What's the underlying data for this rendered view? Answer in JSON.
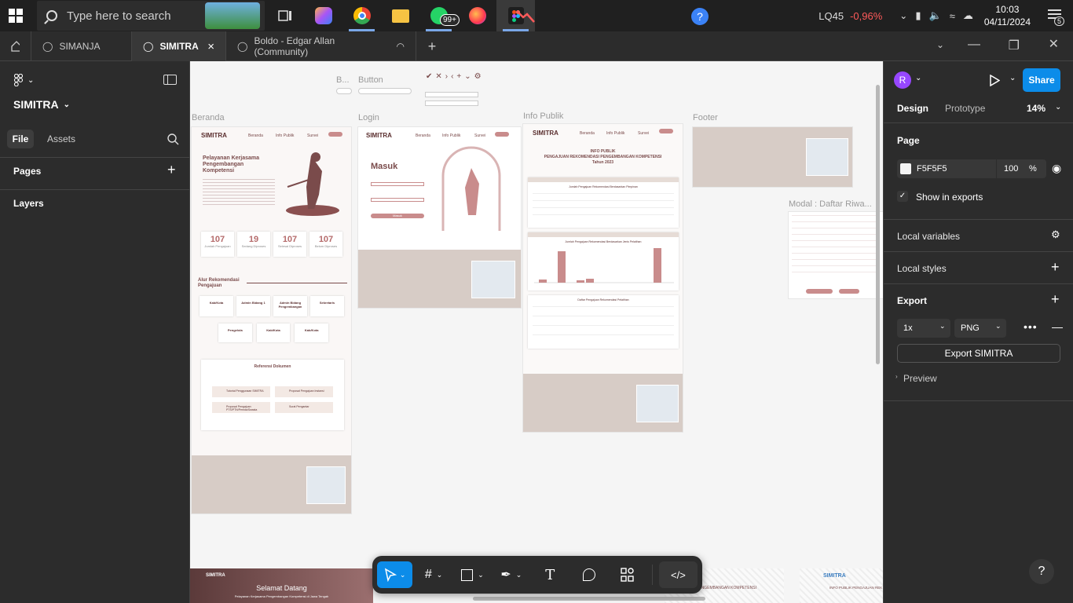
{
  "taskbar": {
    "search_placeholder": "Type here to search",
    "whatsapp_badge": "99+",
    "stock_name": "LQ45",
    "stock_change": "-0,96%",
    "time": "10:03",
    "date": "04/11/2024",
    "notification_count": "5"
  },
  "tabs": [
    {
      "label": "SIMANJA"
    },
    {
      "label": "SIMITRA"
    },
    {
      "label": "Boldo - Edgar Allan (Community)"
    }
  ],
  "left_panel": {
    "file_name": "SIMITRA",
    "tab_file": "File",
    "tab_assets": "Assets",
    "pages_label": "Pages",
    "layers_label": "Layers"
  },
  "canvas": {
    "labels": {
      "b": "B...",
      "button": "Button",
      "beranda": "Beranda",
      "login": "Login",
      "info_publik": "Info Publik",
      "footer": "Footer",
      "modal": "Modal : Daftar Riwa..."
    },
    "beranda": {
      "brand": "SIMITRA",
      "nav": [
        "Beranda",
        "Info Publik",
        "Survei"
      ],
      "hero_title": "Pelayanan Kerjasama Pengembangan Kompetensi",
      "stats": [
        {
          "value": "107",
          "label": "Jumlah Pengajuan"
        },
        {
          "value": "19",
          "label": "Sedang Diproses"
        },
        {
          "value": "107",
          "label": "Selesai Diproses"
        },
        {
          "value": "107",
          "label": "Belum Diproses"
        }
      ],
      "alur_title": "Alur Rekomendasi Pengajuan",
      "steps_row1": [
        "Kab/Kota",
        "Admin Bidang 1",
        "Admin Bidang Pengembangan",
        "Sekretaris"
      ],
      "steps_row2": [
        "Pengelola",
        "Kab/Kota",
        "Kab/Kota"
      ],
      "referensi_title": "Referensi Dokumen",
      "docs": [
        "Tutorial Penggunaan SIMITRA",
        "Proposal Pengajuan Instansi",
        "Proposal Pengajuan PTS/PTN/Pemda/Swasta",
        "Surat Pengantar"
      ]
    },
    "login": {
      "brand": "SIMITRA",
      "nav": [
        "Beranda",
        "Info Publik",
        "Survei"
      ],
      "title": "Masuk",
      "submit": "Masuk"
    },
    "info": {
      "brand": "SIMITRA",
      "nav": [
        "Beranda",
        "Info Publik",
        "Survei"
      ],
      "title1": "INFO PUBLIK",
      "title2": "PENGAJUAN REKOMENDASI PENGEMBANGAN KOMPETENSI",
      "year": "Tahun 2023",
      "table_title": "Jumlah Pengajuan Rekomendasi Berdasarkan Pimpinan",
      "chart_title": "Jumlah Pengajuan Rekomendasi Berdasarkan Jenis Pelatihan",
      "list_title": "Daftar Pengajuan Rekomendasi Pelatihan"
    },
    "banner": {
      "brand": "SIMITRA",
      "title": "Selamat Datang",
      "subtitle": "Pelayanan Kerjasama Pengembangan Kompetensi di Jawa Tengah",
      "right_brand": "SIMITRA",
      "right_title": "INFO PUBLIK PENGAJUAN REK",
      "center_text": "PENGEMBANGAN KOMPETENSI"
    }
  },
  "toolbar": {
    "items": [
      "move",
      "frame",
      "shape",
      "pen",
      "text",
      "comment",
      "actions",
      "dev-mode"
    ]
  },
  "right_panel": {
    "avatar_letter": "R",
    "share_label": "Share",
    "tab_design": "Design",
    "tab_prototype": "Prototype",
    "zoom": "14%",
    "page_label": "Page",
    "page_color": "F5F5F5",
    "page_opacity": "100",
    "percent": "%",
    "show_in_exports": "Show in exports",
    "local_variables": "Local variables",
    "local_styles": "Local styles",
    "export_label": "Export",
    "export_scale": "1x",
    "export_format": "PNG",
    "export_button": "Export SIMITRA",
    "preview_label": "Preview",
    "help": "?"
  },
  "colors": {
    "accent": "#0c8ce9",
    "avatar": "#9747ff",
    "brand_maroon": "#7a4b4b",
    "brand_rose": "#c98c8c",
    "stock_red": "#ff5a5a",
    "canvas_bg": "#F5F5F5"
  }
}
